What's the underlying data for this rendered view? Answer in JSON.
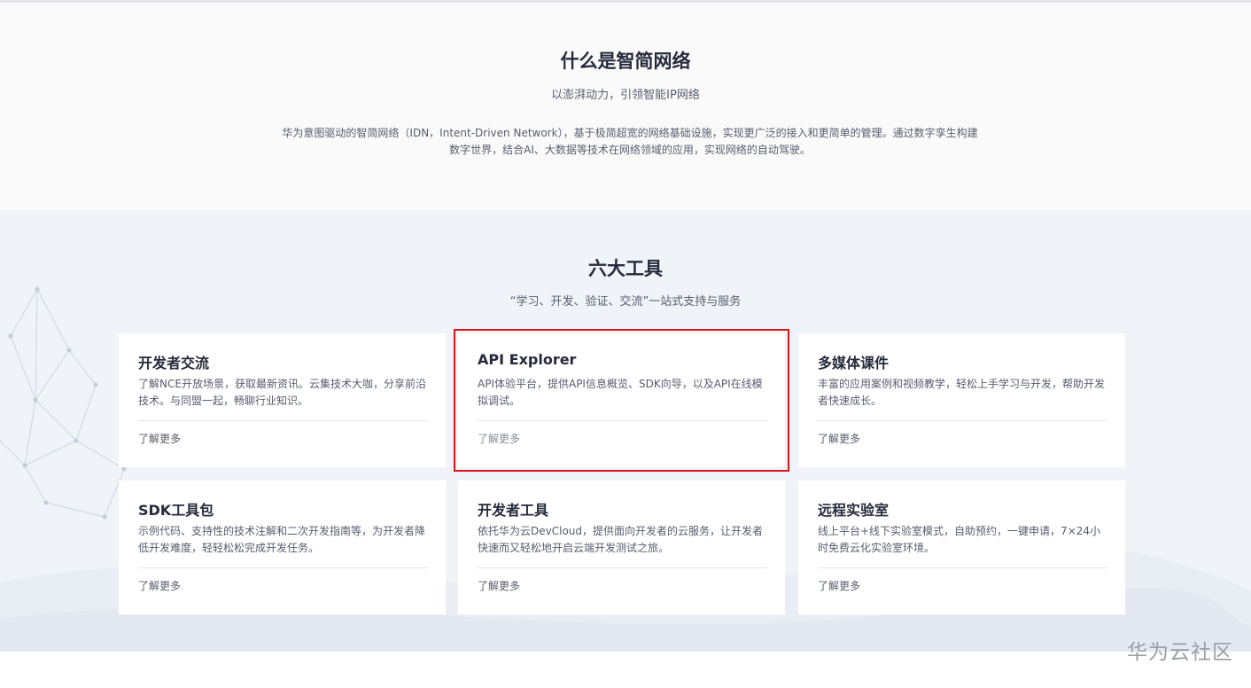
{
  "intro": {
    "title": "什么是智简网络",
    "subtitle": "以澎湃动力，引领智能IP网络",
    "description": "华为意图驱动的智简网络（IDN，Intent-Driven Network），基于极简超宽的网络基础设施，实现更广泛的接入和更简单的管理。通过数字孪生构建数字世界，结合AI、大数据等技术在网络领域的应用，实现网络的自动驾驶。"
  },
  "tools": {
    "title": "六大工具",
    "subtitle": "“学习、开发、验证、交流”一站式支持与服务",
    "cards": [
      {
        "title": "开发者交流",
        "desc": "了解NCE开放场景，获取最新资讯。云集技术大咖，分享前沿技术。与同盟一起，畅聊行业知识。",
        "link": "了解更多"
      },
      {
        "title": "API Explorer",
        "desc": "API体验平台，提供API信息概览、SDK向导，以及API在线模拟调试。",
        "link": "了解更多"
      },
      {
        "title": "多媒体课件",
        "desc": "丰富的应用案例和视频教学，轻松上手学习与开发，帮助开发者快速成长。",
        "link": "了解更多"
      },
      {
        "title": "SDK工具包",
        "desc": "示例代码、支持性的技术注解和二次开发指南等，为开发者降低开发难度，轻轻松松完成开发任务。",
        "link": "了解更多"
      },
      {
        "title": "开发者工具",
        "desc": "依托华为云DevCloud，提供面向开发者的云服务，让开发者快速而又轻松地开启云端开发测试之旅。",
        "link": "了解更多"
      },
      {
        "title": "远程实验室",
        "desc": "线上平台+线下实验室模式，自助预约，一键申请，7×24小时免费云化实验室环境。",
        "link": "了解更多"
      }
    ]
  },
  "watermark": "华为云社区",
  "colors": {
    "highlight": "#d9161c",
    "section_bg": "#f0f3f8",
    "intro_bg": "#fafafb"
  }
}
